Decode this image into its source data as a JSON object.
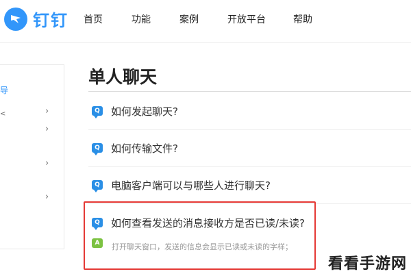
{
  "brand": {
    "logo_text": "钉钉",
    "color": "#3296fa"
  },
  "nav": {
    "items": [
      "首页",
      "功能",
      "案例",
      "开放平台",
      "帮助"
    ]
  },
  "sidebar": {
    "partial_label": "导",
    "partial_mark": "<"
  },
  "main": {
    "title": "单人聊天",
    "questions": [
      "如何发起聊天?",
      "如何传输文件?",
      "电脑客户端可以与哪些人进行聊天?",
      "如何查看发送的消息接收方是否已读/未读?"
    ],
    "q_badge": "Q",
    "a_badge": "A",
    "answer_preview": "打开聊天窗口，发送的信息会显示已读或未读的字样；",
    "highlight_color": "#e53935"
  },
  "watermark": "看看手游网"
}
